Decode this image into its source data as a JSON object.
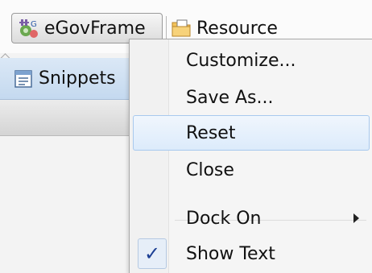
{
  "perspectives": [
    {
      "label": "eGovFrame",
      "icon": "egovframe-perspective-icon"
    },
    {
      "label": "Resource",
      "icon": "resource-perspective-icon"
    }
  ],
  "view": {
    "snippets_tab": "Snippets"
  },
  "context_menu": {
    "items": [
      {
        "label": "Customize..."
      },
      {
        "label": "Save As..."
      },
      {
        "label": "Reset"
      },
      {
        "label": "Close"
      },
      {
        "label": "Dock On"
      },
      {
        "label": "Show Text"
      }
    ],
    "check_glyph": "✓",
    "highlighted_item": "Reset",
    "checked_item": "Show Text"
  },
  "colors": {
    "highlight": "#dcebfb",
    "highlight_border": "#a8c9ee",
    "check": "#1c3f94",
    "snippets_tab": "#c4d9ef"
  }
}
